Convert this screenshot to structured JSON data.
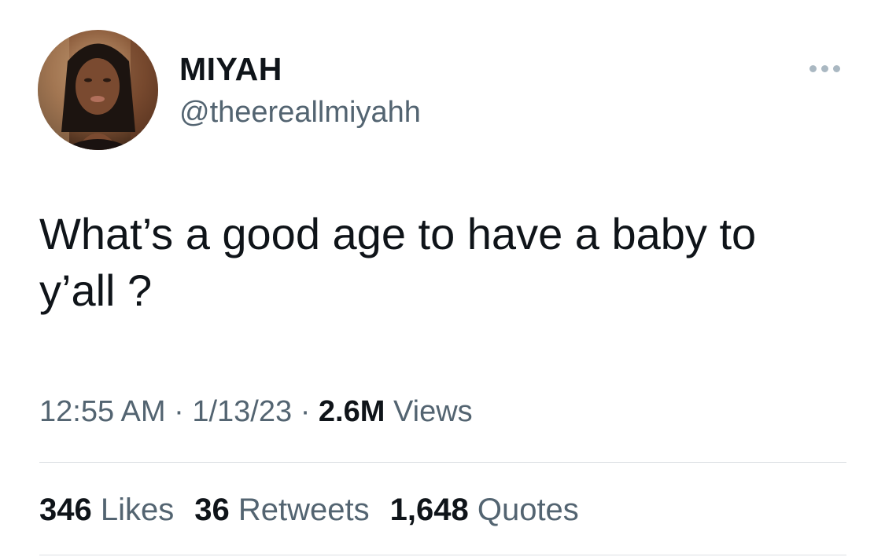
{
  "author": {
    "display_name": "MIYAH",
    "handle": "@theereallmiyahh",
    "avatar_icon": "profile-photo"
  },
  "tweet": {
    "text": "What’s a good age to have a baby to\ny’all ?"
  },
  "meta": {
    "time": "12:55 AM",
    "sep1": " · ",
    "date": "1/13/23",
    "sep2": " · ",
    "views_count": "2.6M",
    "views_label": " Views"
  },
  "stats": {
    "likes_count": "346",
    "likes_label": " Likes",
    "retweets_count": "36",
    "retweets_label": " Retweets",
    "quotes_count": "1,648",
    "quotes_label": " Quotes"
  },
  "colors": {
    "text_primary": "#0f1419",
    "text_secondary": "#536471",
    "more_dots": "#aab8c2",
    "divider": "#dcdfe3"
  }
}
